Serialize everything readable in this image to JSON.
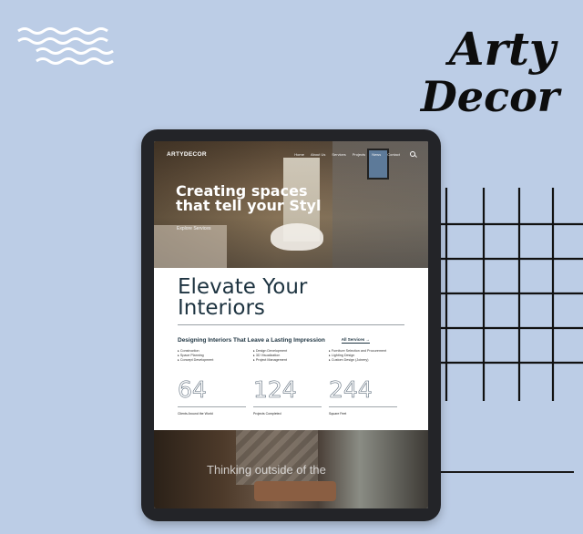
{
  "poster": {
    "brand_line1": "Arty",
    "brand_line2": "Decor"
  },
  "site": {
    "logo": "ARTYDECOR",
    "nav": [
      "Home",
      "About Us",
      "Services",
      "Projects",
      "News",
      "Contact"
    ],
    "hero": {
      "title_line1": "Creating spaces",
      "title_line2": "that tell your Styl",
      "cta": "Explore Services"
    },
    "intro": {
      "title_line1": "Elevate Your",
      "title_line2": "Interiors",
      "subheading": "Designing Interiors That Leave a Lasting Impression",
      "all_services": "All Services →"
    },
    "services": [
      [
        "Construction",
        "Space Planning",
        "Concept Development"
      ],
      [
        "Design Development",
        "3D Visualization",
        "Project Management"
      ],
      [
        "Furniture Selection and Procurement",
        "Lighting Design",
        "Custom Design (Joinery)"
      ]
    ],
    "stats": [
      {
        "value": "64",
        "label": "Clients Around the World"
      },
      {
        "value": "124",
        "label": "Projects Completed"
      },
      {
        "value": "244",
        "label": "Square Feet"
      }
    ],
    "bottom_caption": "Thinking outside of the"
  },
  "colors": {
    "background": "#bccde6",
    "ink": "#1d3340",
    "device": "#232428"
  },
  "icons": [
    "wave-decoration-icon",
    "grid-decoration-icon",
    "search-icon",
    "arrow-right-icon"
  ]
}
